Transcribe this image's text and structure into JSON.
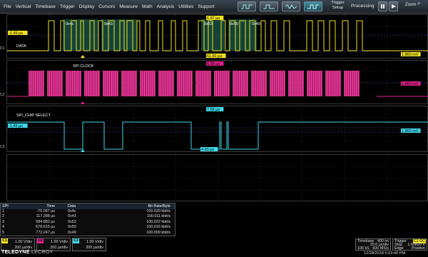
{
  "menu": [
    "File",
    "Vertical",
    "Timebase",
    "Trigger",
    "Display",
    "Cursors",
    "Measure",
    "Math",
    "Analysis",
    "Utilities",
    "Support"
  ],
  "toolbar": {
    "trigger_setup": "Trigger Setup",
    "processing": "Processing",
    "zoom": "Zoom",
    "zoom_icon": "⌕"
  },
  "grid1": {
    "marker": "D1",
    "trace_label": "DATA",
    "level_left": "-1.49 μs",
    "level_right": "1.860 mV",
    "cursor_top": "6.97 μs",
    "cursor_bot": "61.81 μs",
    "decodes": [
      "0x4c",
      "0x43",
      "0x53",
      "0x50",
      "0x49"
    ],
    "color": "#f0e020"
  },
  "grid2": {
    "marker": "C2",
    "trace_label": "SPI CLOCK",
    "cursor_top": "6.98 μs",
    "level_right": "1.860 mV",
    "color": "#e0208a"
  },
  "grid3": {
    "marker": "C3",
    "trace_label": "SPI_CHIP SELECT",
    "level_left": "-1.49 μs",
    "level_right": "1.860 mV",
    "cursor_top": "7.55 μs",
    "cursor_bot": "4.93 μs",
    "color": "#40d8e8"
  },
  "table": {
    "title": "SPI",
    "headers": [
      "",
      "Time",
      "Data",
      "Bit Rate/Byte"
    ],
    "rows": [
      [
        "1",
        "-70.097 μs",
        "0x4c",
        "100.020 kbit/s"
      ],
      [
        "2",
        "117.288 μs",
        "0x43",
        "100.011 kbit/s"
      ],
      [
        "3",
        "584.882 μs",
        "0x53",
        "100.022 kbit/s"
      ],
      [
        "4",
        "678.615 μs",
        "0x50",
        "100.016 kbit/s"
      ],
      [
        "5",
        "772.247 μs",
        "0x49",
        "100.009 kbit/s"
      ]
    ]
  },
  "channels": [
    {
      "tag": "C1",
      "color": "#f0e020",
      "vdiv": "1.00 V/div",
      "tdiv": "200 μs/div"
    },
    {
      "tag": "C2",
      "color": "#e0208a",
      "vdiv": "1.00 V/div",
      "tdiv": "200 μs/div"
    },
    {
      "tag": "C3",
      "color": "#40d8e8",
      "vdiv": "1.00 V/div",
      "tdiv": "200 μs/div"
    }
  ],
  "brand": {
    "main": "TELEDYNE",
    "sub": "LECROY"
  },
  "timebase": {
    "label": "Timebase",
    "delay": "400 ns",
    "tdiv": "20.0 μs/div",
    "samples": "100 kS",
    "rate": "500 MS/s"
  },
  "trigger": {
    "label": "Trigger",
    "ch": "C1 DC",
    "mode": "Stop",
    "level": "1.00820 V",
    "type": "Edge",
    "slope": "Positive"
  },
  "datetime": "12/28/2018 5:03:40 PM"
}
